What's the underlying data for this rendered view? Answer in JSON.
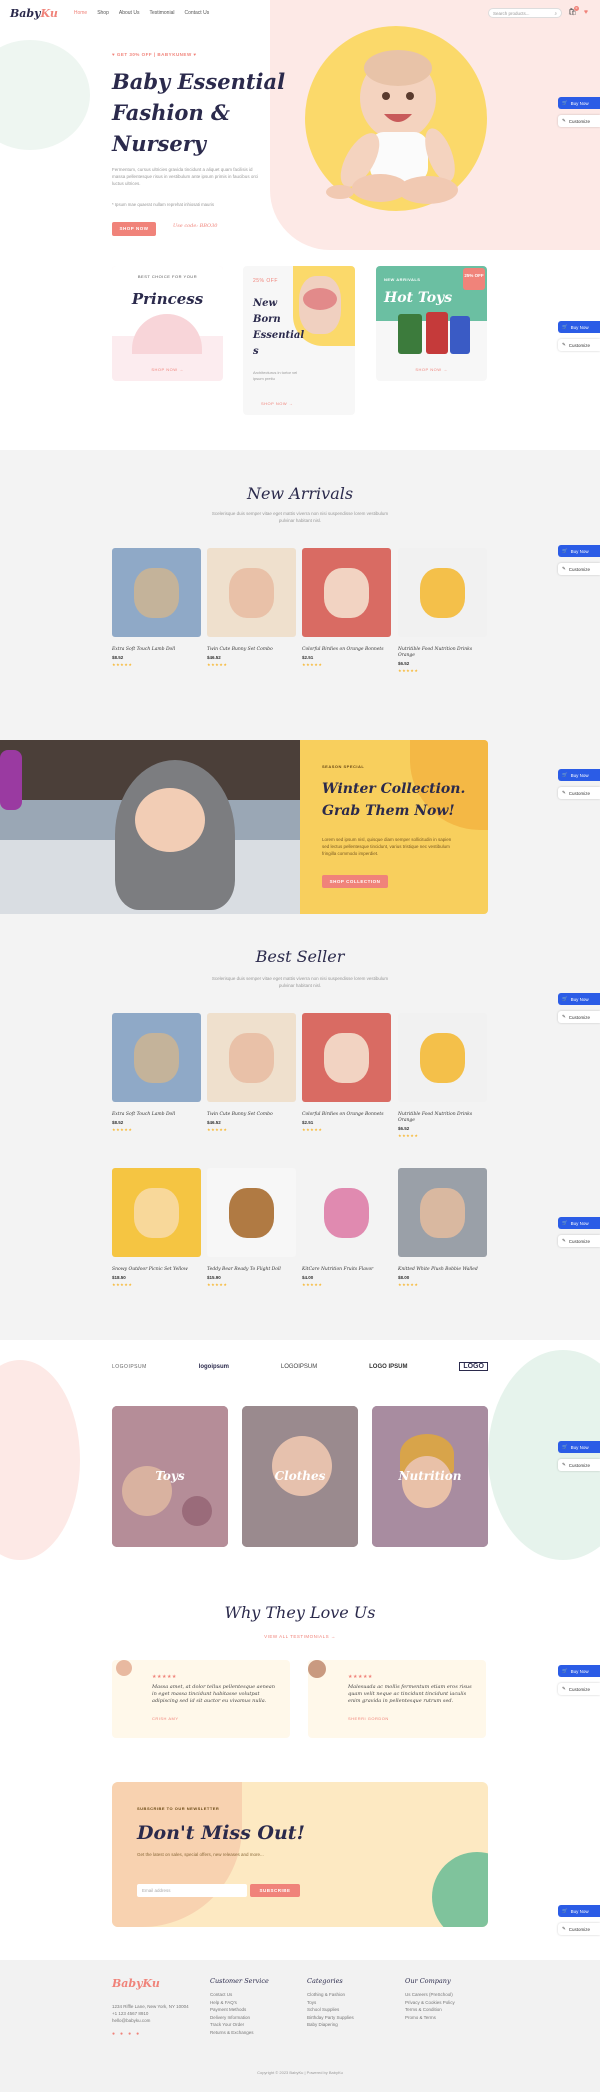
{
  "nav": {
    "logo_a": "Baby",
    "logo_b": "Ku",
    "items": [
      "Home",
      "Shop",
      "About Us",
      "Testimonial",
      "Contact Us"
    ],
    "search_placeholder": "Search products...",
    "cart_count": "0"
  },
  "hero": {
    "tag": "♥ GET 30% OFF  |  BABYKUNEW ♥",
    "title_l1": "Baby Essential",
    "title_l2": "Fashion &",
    "title_l3": "Nursery",
    "desc": "Fermentum, cursus ultricies gravida tincidunt a aliquet quam facilisis id massa pellentesque risus in vestibulum ante ipsum primis in faucibus orci luctus ultrices.",
    "note": "* Ipsum mae quaerat nullam reprehat inhiosati mauris",
    "button": "SHOP NOW",
    "code": "Use code: BBO30"
  },
  "promos": {
    "p1_tag": "BEST CHOICE FOR YOUR",
    "p1_title": "Princess",
    "p1_link": "SHOP NOW →",
    "p2_tag": "25% OFF",
    "p2_title": "New Born Essential s",
    "p2_desc": "Architecturus in tortor vel ipsum pretiu",
    "p2_link": "SHOP NOW →",
    "p3_tag": "NEW ARRIVALS",
    "p3_title": "Hot Toys",
    "p3_badge": "25% OFF",
    "p3_link": "SHOP NOW →"
  },
  "arrivals": {
    "title": "New Arrivals",
    "sub": "Scelerisque duis semper vitae eget mattis viverra non nisi suspendisse lorem vestibulum pulvinar habitant nisl.",
    "products": [
      {
        "name": "Extra Soft Touch Lamb Doll",
        "price": "$8.52",
        "stars": "★★★★★"
      },
      {
        "name": "Twin Cute Bunny Set Combo",
        "price": "$46.52",
        "stars": "★★★★★"
      },
      {
        "name": "Colorful Birdies on Orange Bonnets",
        "price": "$2.51",
        "stars": "★★★★★"
      },
      {
        "name": "Nutritible Food Nutrition Drinks Orange",
        "price": "$6.52",
        "stars": "★★★★★"
      }
    ]
  },
  "winter": {
    "tag": "SEASON SPECIAL",
    "title_l1": "Winter Collection.",
    "title_l2": "Grab Them Now!",
    "desc": "Lorem sed ipsum nisl, quisque diam semper sollicitudin in sapien sed lectus pellentesque tincidunt, varius tristique nec vestibulum fringilla commodo imperdiet.",
    "button": "SHOP COLLECTION"
  },
  "best": {
    "title": "Best Seller",
    "sub": "Scelerisque duis semper vitae eget mattis viverra non nisi suspendisse lorem vestibulum pulvinar habitant nisl.",
    "products": [
      {
        "name": "Extra Soft Touch Lamb Doll",
        "price": "$8.52",
        "stars": "★★★★★"
      },
      {
        "name": "Twin Cute Bunny Set Combo",
        "price": "$46.52",
        "stars": "★★★★★"
      },
      {
        "name": "Colorful Birdies on Orange Bonnets",
        "price": "$2.51",
        "stars": "★★★★★"
      },
      {
        "name": "Nutritible Food Nutrition Drinks Orange",
        "price": "$6.52",
        "stars": "★★★★★"
      },
      {
        "name": "Snowy Outdoor Picnic Set Yellow",
        "price": "$18.50",
        "stars": "★★★★★"
      },
      {
        "name": "Teddy Bear Ready To Flight Doll",
        "price": "$15.90",
        "stars": "★★★★★"
      },
      {
        "name": "KitCare Nutrition Fruits Flavor",
        "price": "$4.00",
        "stars": "★★★★★"
      },
      {
        "name": "Knitted White Plush Bobbie Walled",
        "price": "$8.00",
        "stars": "★★★★★"
      }
    ]
  },
  "brands": [
    "LOGOIPSUM",
    "logoipsum",
    "LOGOIPSUM",
    "LOGO IPSUM",
    "LOGO"
  ],
  "categories": [
    "Toys",
    "Clothes",
    "Nutrition"
  ],
  "testimonials": {
    "title": "Why They Love Us",
    "link": "VIEW ALL TESTIMONIALS →",
    "items": [
      {
        "stars": "★★★★★",
        "quote": "Massa amet, at dolor tellus pellentesque aenean in eget massa tincidunt habitasse volutpat adipiscing sed id sit auctor eu vivamus nulla.",
        "name": "CRISH AMY"
      },
      {
        "stars": "★★★★★",
        "quote": "Malesuada ac mollis fermentum etiam eros risus quam velit neque ac tincidunt tincidunt iaculis enim gravida in pellentesque rutrum sed.",
        "name": "SHERRI GORDON"
      }
    ]
  },
  "newsletter": {
    "tag": "SUBSCRIBE TO OUR NEWSLETTER",
    "title": "Don't Miss Out!",
    "desc": "Get the latest on sales, special offers, new releases and more...",
    "placeholder": "Email address",
    "button": "SUBSCRIBE"
  },
  "footer": {
    "logo_a": "Baby",
    "logo_b": "Ku",
    "address": "1234 Riffle Lane, New York, NY 10004",
    "phone": "+1 123 4567 8910",
    "email": "hello@babyku.com",
    "col1_title": "Customer Service",
    "col1": [
      "Contact Us",
      "Help & FAQ's",
      "Payment Methods",
      "Delivery Information",
      "Track Your Order",
      "Returns & Exchanges"
    ],
    "col2_title": "Categories",
    "col2": [
      "Clothing & Fashion",
      "Toys",
      "School Supplies",
      "Birthday Party Supplies",
      "Baby Diapering"
    ],
    "col3_title": "Our Company",
    "col3": [
      "Us Careers (PreSchool)",
      "Privacy & Cookies Policy",
      "Terms & Condition",
      "Promo & Terms"
    ],
    "copyright": "Copyright © 2023 BabyKu | Powered by BabyKu"
  },
  "side": {
    "buy": "Buy Now",
    "customize": "Customize"
  },
  "colors": {
    "accent": "#f0837a",
    "navy": "#2b2a4c",
    "yellow": "#f8cf5d",
    "blue": "#2b5ce6",
    "mint": "#6bbfa2"
  }
}
